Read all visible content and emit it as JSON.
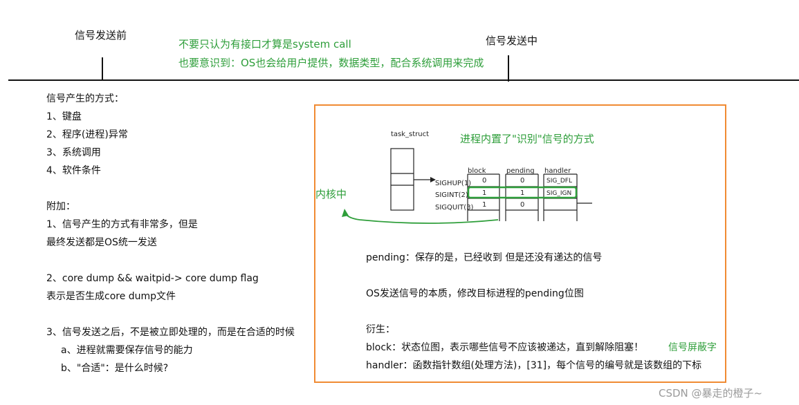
{
  "top": {
    "before_label": "信号发送前",
    "during_label": "信号发送中",
    "green_line1": "不要只认为有接口才算是system call",
    "green_line2": "也要意识到：OS也会给用户提供，数据类型，配合系统调用来完成"
  },
  "left": {
    "lines": [
      "信号产生的方式：",
      "1、键盘",
      "2、程序(进程)异常",
      "3、系统调用",
      "4、软件条件",
      "附加：",
      "1、信号产生的方式有非常多，但是",
      "最终发送都是OS统一发送",
      "2、core dump && waitpid-> core dump flag",
      "表示是否生成core dump文件",
      "3、信号发送之后，不是被立即处理的，而是在合适的时候",
      "a、进程就需要保存信号的能力",
      "b、\"合适\"：是什么时候?"
    ]
  },
  "box": {
    "kernel_label": "内核中",
    "builtin_label": "进程内置了\"识别\"信号的方式",
    "task_struct_label": "task_struct",
    "col_headers": [
      "block",
      "pending",
      "handler"
    ],
    "row_labels": [
      "SIGHUP(1)",
      "SIGINT(2)",
      "SIGQUIT(3)"
    ],
    "block_vals": [
      "0",
      "1",
      "1"
    ],
    "pending_vals": [
      "0",
      "1",
      "0"
    ],
    "handler_vals": [
      "SIG_DFL",
      "SIG_IGN",
      ""
    ],
    "pending_desc": "pending：保存的是，已经收到 但是还没有递达的信号",
    "os_desc": "OS发送信号的本质，修改目标进程的pending位图",
    "derive_label": "衍生：",
    "block_desc": "block：状态位图，表示哪些信号不应该被递达，直到解除阻塞！",
    "block_note": "信号屏蔽字",
    "handler_desc": "handler：函数指针数组(处理方法)，[31]，每个信号的编号就是该数组的下标"
  },
  "watermark": "CSDN @暴走的橙子~"
}
